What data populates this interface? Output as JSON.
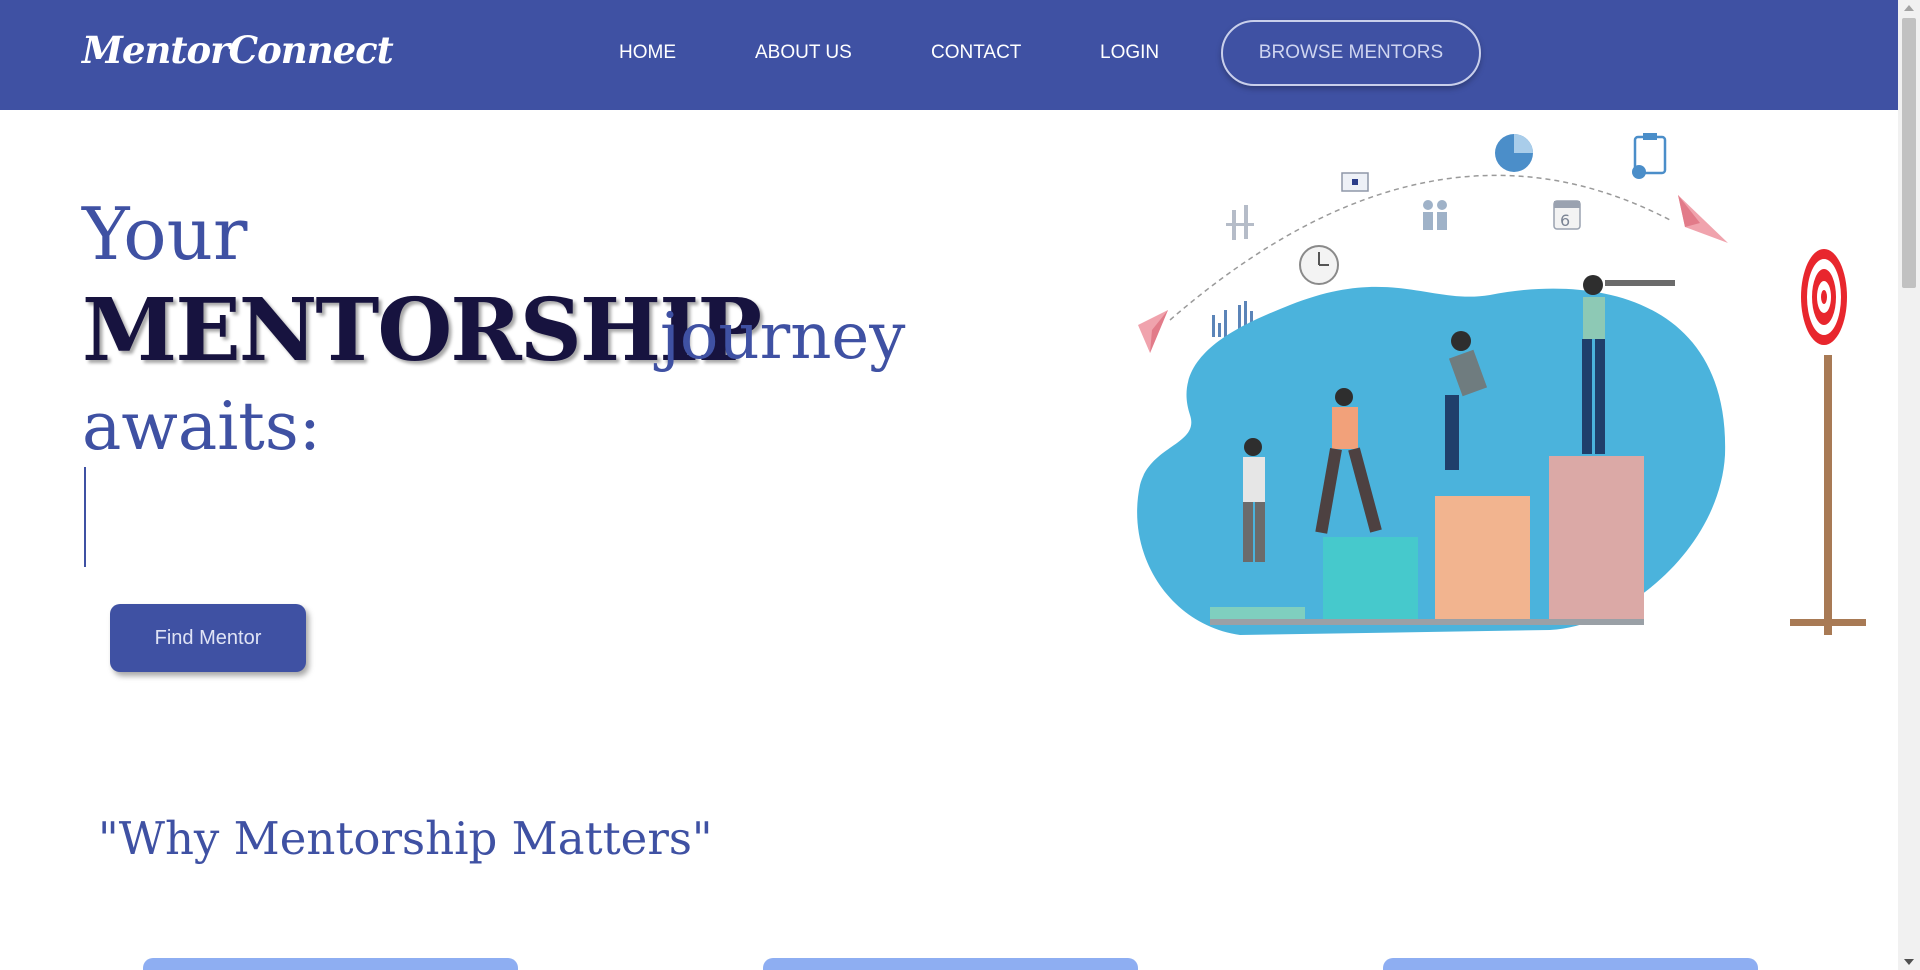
{
  "nav": {
    "brand": "MentorConnect",
    "links": [
      "HOME",
      "ABOUT US",
      "CONTACT",
      "LOGIN"
    ],
    "cta": "BROWSE MENTORS"
  },
  "hero": {
    "line1": "Your",
    "line2_bold": "MENTORSHIP",
    "line2_rest": "journey",
    "line3": "awaits:",
    "button": "Find Mentor"
  },
  "section": {
    "title": "\"Why Mentorship Matters\""
  },
  "colors": {
    "primary": "#3f51a3",
    "dark_heading": "#17133f",
    "card_accent": "#8eaef2",
    "blob": "#4bb3dc"
  },
  "icons": [
    "paper-plane-icon",
    "pie-chart-icon",
    "clipboard-icon",
    "calendar-icon",
    "clock-icon",
    "target-icon"
  ]
}
